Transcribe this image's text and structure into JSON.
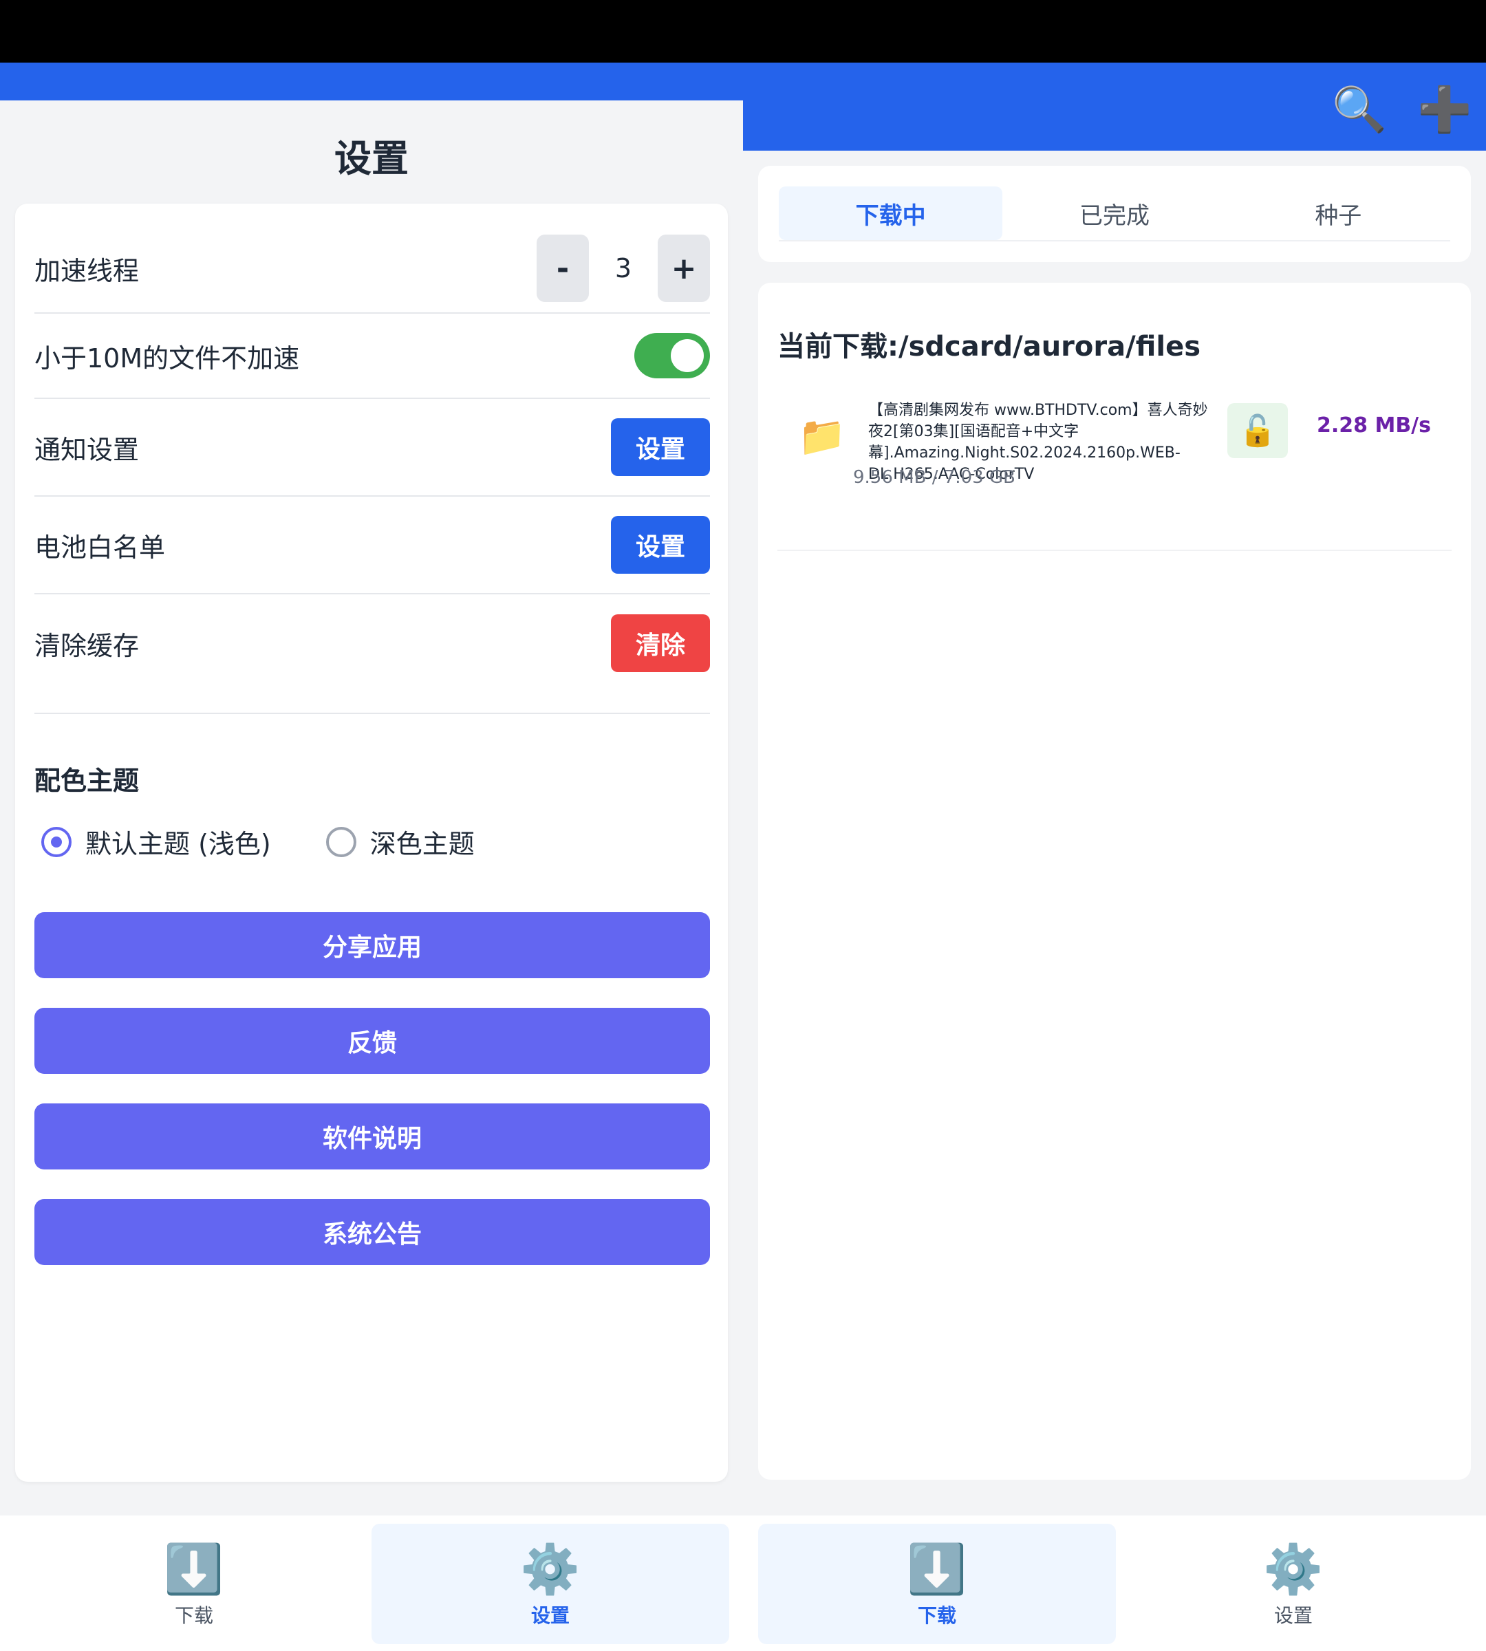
{
  "settings": {
    "title": "设置",
    "rows": [
      {
        "label": "加速线程",
        "minus": "-",
        "value": "3",
        "plus": "+"
      },
      {
        "label": "小于10M的文件不加速",
        "toggle_on": true
      },
      {
        "label": "通知设置",
        "button": "设置"
      },
      {
        "label": "电池白名单",
        "button": "设置"
      },
      {
        "label": "清除缓存",
        "button": "清除"
      }
    ],
    "theme": {
      "title": "配色主题",
      "options": [
        "默认主题 (浅色)",
        "深色主题"
      ],
      "selected": 0
    },
    "actions": [
      "分享应用",
      "反馈",
      "软件说明",
      "系统公告"
    ]
  },
  "downloads": {
    "header_icons": [
      "search-icon",
      "plus-icon"
    ],
    "tabs": [
      "下载中",
      "已完成",
      "种子"
    ],
    "active_tab": 0,
    "list_title": "当前下载:/sdcard/aurora/files",
    "items": [
      {
        "name": "【高清剧集网发布 www.BTHDTV.com】喜人奇妙夜2[第03集][国语配音+中文字幕].Amazing.Night.S02.2024.2160p.WEB-DL.H265.AAC-ColorTV",
        "size": "9.56 MB / 7.03 GB",
        "speed": "2.28 MB/s",
        "icon": "folder-icon",
        "lock_icon": "unlock-icon"
      }
    ]
  },
  "bottom_nav": [
    {
      "label": "下载",
      "icon": "download-icon",
      "active": false
    },
    {
      "label": "设置",
      "icon": "gear-icon",
      "active": true
    },
    {
      "label": "下载",
      "icon": "download-icon",
      "active": true
    },
    {
      "label": "设置",
      "icon": "gear-icon",
      "active": false
    }
  ],
  "colors": {
    "primary": "#2563eb",
    "accent": "#6366f1",
    "danger": "#ef4444",
    "toggle_on": "#3fae50",
    "speed": "#6b21a8"
  }
}
